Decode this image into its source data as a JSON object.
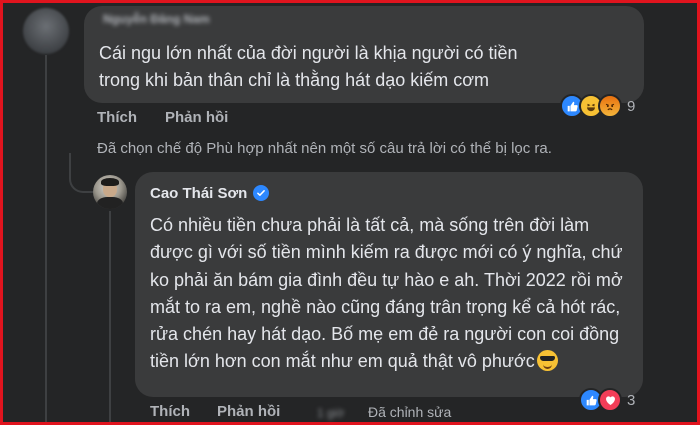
{
  "colors": {
    "background": "#242526",
    "bubble": "#3a3b3c",
    "text_primary": "#e4e6eb",
    "text_secondary": "#b0b3b8",
    "frame_border": "#e0141e",
    "verified_blue": "#2d88ff"
  },
  "comment1": {
    "author_name": "Nguyễn Đăng Nam",
    "text": "Cái ngu lớn nhất của đời người là khịa người có tiền trong khi bản thân chỉ là thằng hát dạo kiếm cơm",
    "like_label": "Thích",
    "reply_label": "Phản hồi",
    "reactions": [
      "like-icon",
      "haha-icon",
      "angry-icon"
    ],
    "reaction_count": "9"
  },
  "filter_note": "Đã chọn chế độ Phù hợp nhất nên một số câu trả lời có thể bị lọc ra.",
  "comment2": {
    "author_name": "Cao Thái Sơn",
    "verified": true,
    "text": "Có nhiều tiền chưa phải là tất cả, mà sống trên đời làm được gì với số tiền mình kiếm ra được mới có ý nghĩa, chứ ko phải ăn bám gia đình đều tự hào e ah. Thời 2022 rồi mở mắt to ra em, nghề nào cũng đáng trân trọng kể cả hót rác, rửa chén hay hát dạo. Bố mẹ em đẻ ra người con coi đồng tiền lớn hơn con mắt như em quả thật vô phước",
    "emoji": "smiling-face-with-sunglasses-icon",
    "like_label": "Thích",
    "reply_label": "Phản hồi",
    "time": "1 giờ",
    "edited_label": "Đã chỉnh sửa",
    "reactions": [
      "like-icon",
      "love-icon"
    ],
    "reaction_count": "3"
  }
}
